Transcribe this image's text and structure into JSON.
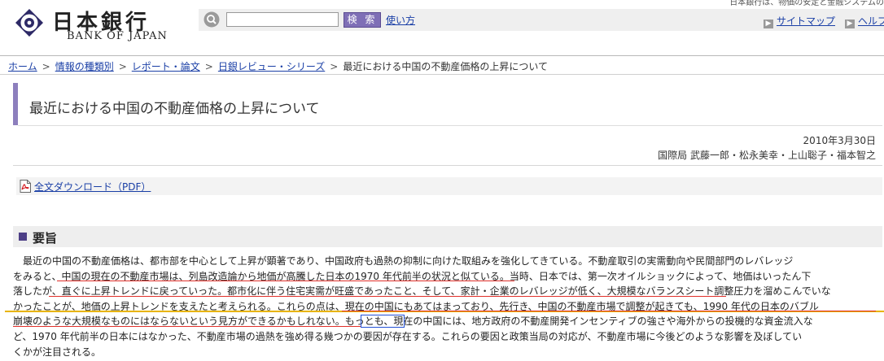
{
  "header": {
    "logo_jp": "日本銀行",
    "logo_en": "BANK OF JAPAN",
    "top_note": "日本銀行は、物価の安定と金融システムの",
    "search_placeholder": "",
    "search_button": "検 索",
    "howto_link": "使い方",
    "sitemap_link": "サイトマップ",
    "help_link": "ヘルプ"
  },
  "breadcrumb": {
    "items": [
      "ホーム",
      "情報の種類別",
      "レポート・論文",
      "日銀レビュー・シリーズ"
    ],
    "current": "最近における中国の不動産価格の上昇について",
    "separator": ">"
  },
  "article": {
    "title": "最近における中国の不動産価格の上昇について",
    "date": "2010年3月30日",
    "authors": "国際局 武藤一郎・松永美幸・上山聡子・福本智之",
    "download_link": "全文ダウンロード（PDF）"
  },
  "summary": {
    "heading": "要旨",
    "lines": [
      "最近の中国の不動産価格は、都市部を中心として上昇が顕著であり、中国政府も過熱の抑制に向けた取組みを強化してきている。不動産取引の実需動向や民間部門のレバレッジ",
      "をみると、中国の現在の不動産市場は、列島改造論から地価が高騰した日本の1970 年代前半の状況と似ている。当時、日本では、第一次オイルショックによって、地価はいったん下",
      "落したが、直ぐに上昇トレンドに戻っていった。都市化に伴う住宅実需が旺盛であったこと、そして、家計・企業のレバレッジが低く、大規模なバランスシート調整圧力を溜めこんでいな",
      "かったことが、地価の上昇トレンドを支えたと考えられる。これらの点は、現在の中国にもあてはまっており、先行き、中国の不動産市場で調整が起きても、1990 年代の日本のバブル",
      "崩壊のような大規模なものにはならないという見方ができるかもしれない。もっとも、現在の中国には、地方政府の不動産開発インセンティブの強さや海外からの投機的な資金流入な",
      "ど、1970 年代前半の日本にはなかった、不動産市場の過熱を強め得る幾つかの要因が存在する。これらの要因と政策当局の対応が、不動産市場に今後どのような影響を及ぼしてい",
      "くかが注目される。"
    ]
  },
  "colors": {
    "accent_purple": "#8d7fbd",
    "search_button": "#7f6fb6",
    "link": "#1a3fa6",
    "annotation_red": "#e0302a",
    "annotation_yellow": "#e8b400",
    "annotation_blue": "#2250d6"
  },
  "icons": {
    "logo": "bank-seal-icon",
    "search": "search-magnifier-icon",
    "pdf": "pdf-file-icon",
    "util_arrow": "arrow-right-icon"
  }
}
